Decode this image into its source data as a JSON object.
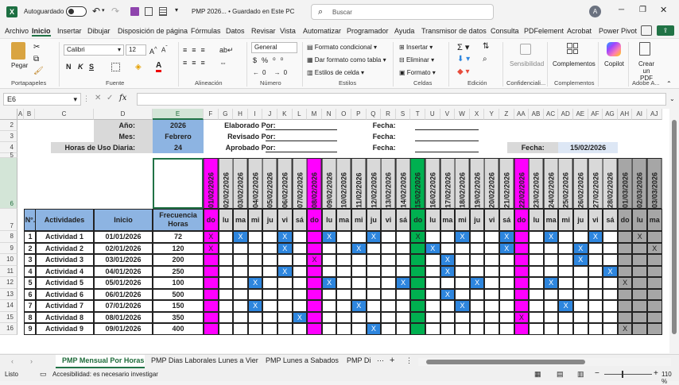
{
  "titlebar": {
    "autosave": "Autoguardado",
    "doc_title": "PMP  2026... • Guardado en Este PC",
    "search_placeholder": "Buscar",
    "avatar": "A"
  },
  "menu": [
    "Archivo",
    "Inicio",
    "Insertar",
    "Dibujar",
    "Disposición de página",
    "Fórmulas",
    "Datos",
    "Revisar",
    "Vista",
    "Automatizar",
    "Programador",
    "Ayuda",
    "Transmisor de datos",
    "Consulta",
    "PDFelement",
    "Acrobat",
    "Power Pivot"
  ],
  "ribbon": {
    "paste": "Pegar",
    "portapapeles": "Portapapeles",
    "font_name": "Calibri",
    "font_size": "12",
    "fuente": "Fuente",
    "alineacion": "Alineación",
    "num_format": "General",
    "numero": "Número",
    "cond_format": "Formato condicional",
    "table_format": "Dar formato como tabla",
    "cell_styles": "Estilos de celda",
    "estilos": "Estilos",
    "insertar": "Insertar",
    "eliminar": "Eliminar",
    "formato": "Formato",
    "celdas": "Celdas",
    "edicion": "Edición",
    "sensibilidad": "Sensibilidad",
    "confidencial": "Confidenciali...",
    "complementos": "Complementos",
    "complementos_grp": "Complementos",
    "copilot": "Copilot",
    "crear_pdf": "Crear un PDF",
    "adobe": "Adobe A..."
  },
  "formula_bar": {
    "name_box": "E6",
    "fx": "fx",
    "formula": ""
  },
  "columns": [
    "A",
    "B",
    "C",
    "D",
    "E",
    "F",
    "G",
    "H",
    "I",
    "J",
    "K",
    "L",
    "M",
    "N",
    "O",
    "P",
    "Q",
    "R",
    "S",
    "T",
    "U",
    "V",
    "W",
    "X",
    "Y",
    "Z",
    "AA",
    "AB",
    "AC",
    "AD",
    "AE",
    "AF",
    "AG",
    "AH",
    "AI",
    "AJ"
  ],
  "rows": [
    "2",
    "3",
    "4",
    "5",
    "6",
    "7",
    "8",
    "9",
    "10",
    "11",
    "12",
    "13",
    "14",
    "15",
    "16"
  ],
  "header": {
    "anio_label": "Año:",
    "anio": "2026",
    "mes_label": "Mes:",
    "mes": "Febrero",
    "horas_label": "Horas de Uso Diaria:",
    "horas": "24",
    "elaborado": "Elaborado Por:",
    "revisado": "Revisado Por:",
    "aprobado": "Aprobado Por:",
    "fecha1": "Fecha:",
    "fecha2": "Fecha:",
    "fecha3": "Fecha:",
    "fecha_label": "Fecha:",
    "fecha": "15/02/2026"
  },
  "table_headers": {
    "n": "N°.",
    "actividades": "Actividades",
    "inicio": "Inicio",
    "frecuencia": "Frecuencia Horas"
  },
  "dates": [
    "01/02/2026",
    "02/02/2026",
    "03/02/2026",
    "04/02/2026",
    "05/02/2026",
    "06/02/2026",
    "07/02/2026",
    "08/02/2026",
    "09/02/2026",
    "10/02/2026",
    "11/02/2026",
    "12/02/2026",
    "13/02/2026",
    "14/02/2026",
    "15/02/2026",
    "16/02/2026",
    "17/02/2026",
    "18/02/2026",
    "19/02/2026",
    "20/02/2026",
    "21/02/2026",
    "22/02/2026",
    "23/02/2026",
    "24/02/2026",
    "25/02/2026",
    "26/02/2026",
    "27/02/2026",
    "28/02/2026",
    "01/03/2026",
    "02/03/2026",
    "03/03/2026"
  ],
  "days": [
    "do",
    "lu",
    "ma",
    "mi",
    "ju",
    "vi",
    "sá",
    "do",
    "lu",
    "ma",
    "mi",
    "ju",
    "vi",
    "sá",
    "do",
    "lu",
    "ma",
    "mi",
    "ju",
    "vi",
    "sá",
    "do",
    "lu",
    "ma",
    "mi",
    "ju",
    "vi",
    "sá",
    "do",
    "lu",
    "ma"
  ],
  "activities": [
    {
      "n": "1",
      "name": "Actividad 1",
      "inicio": "01/01/2026",
      "freq": "72",
      "marks": [
        0,
        2,
        5,
        8,
        11,
        14,
        17,
        20,
        23,
        26,
        29
      ]
    },
    {
      "n": "2",
      "name": "Actividad 2",
      "inicio": "02/01/2026",
      "freq": "120",
      "marks": [
        0,
        5,
        10,
        15,
        20,
        25,
        30
      ]
    },
    {
      "n": "3",
      "name": "Actividad 3",
      "inicio": "03/01/2026",
      "freq": "200",
      "marks": [
        7,
        16,
        25
      ]
    },
    {
      "n": "4",
      "name": "Actividad 4",
      "inicio": "04/01/2026",
      "freq": "250",
      "marks": [
        5,
        16,
        27
      ]
    },
    {
      "n": "5",
      "name": "Actividad 5",
      "inicio": "05/01/2026",
      "freq": "100",
      "marks": [
        3,
        8,
        13,
        18,
        23,
        28
      ]
    },
    {
      "n": "6",
      "name": "Actividad 6",
      "inicio": "06/01/2026",
      "freq": "500",
      "marks": [
        16
      ]
    },
    {
      "n": "7",
      "name": "Actividad 7",
      "inicio": "07/01/2026",
      "freq": "150",
      "marks": [
        3,
        10,
        17,
        24
      ]
    },
    {
      "n": "8",
      "name": "Actividad 8",
      "inicio": "08/01/2026",
      "freq": "350",
      "marks": [
        6,
        21
      ]
    },
    {
      "n": "9",
      "name": "Actividad 9",
      "inicio": "09/01/2026",
      "freq": "400",
      "marks": [
        11,
        28
      ]
    }
  ],
  "mark_label": "X",
  "sheets": [
    "PMP Mensual Por Horas",
    "PMP Dias Laborales Lunes a Vier",
    "PMP Lunes a Sabados",
    "PMP Di"
  ],
  "status": {
    "ready": "Listo",
    "accessibility": "Accesibilidad: es necesario investigar",
    "zoom": "110 %"
  }
}
